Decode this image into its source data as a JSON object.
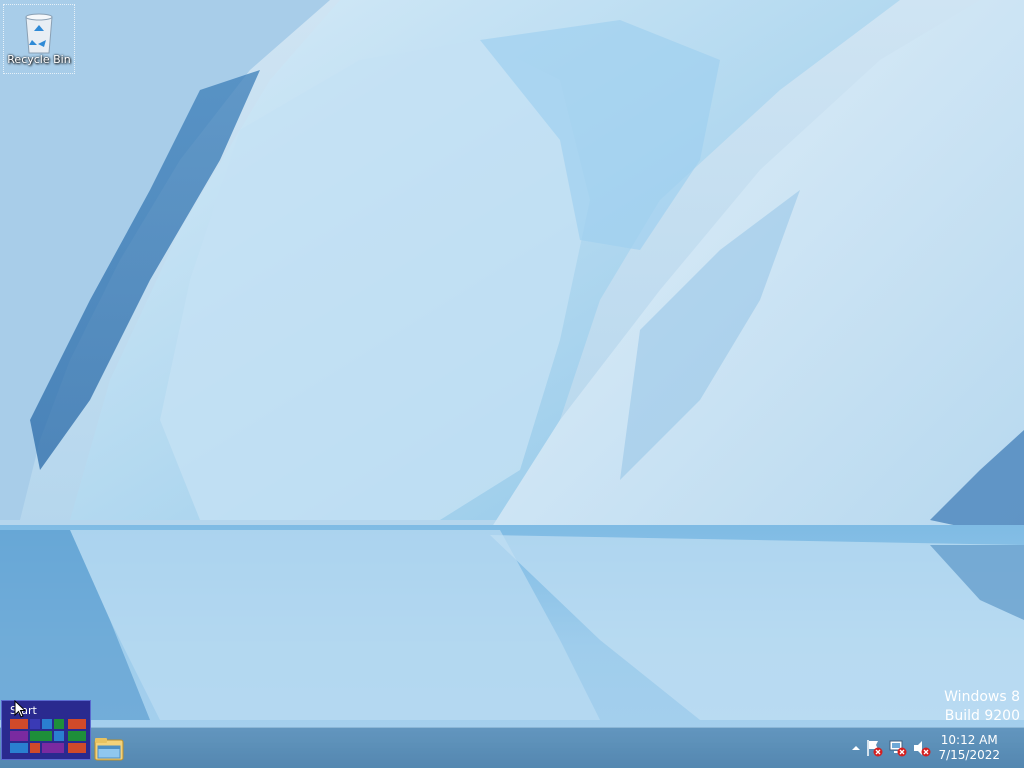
{
  "desktop": {
    "icons": [
      {
        "label": "Recycle Bin",
        "icon": "recycle-bin-icon"
      }
    ],
    "watermark": {
      "line1": "Windows 8",
      "line2": "Build 9200"
    }
  },
  "start": {
    "label": "Start",
    "tile_colors": [
      "#d04a2a",
      "#3a3ab5",
      "#2a7fd0",
      "#1e8f3a",
      "#d04a2a",
      "#7a2aa0",
      "#3a3ab5",
      "#1e8f3a",
      "#2a7fd0",
      "#d04a2a",
      "#7a2aa0",
      "#1e8f3a"
    ]
  },
  "taskbar": {
    "pinned": [
      {
        "name": "File Explorer",
        "icon": "file-explorer-icon"
      }
    ],
    "tray": {
      "icons": [
        "show-hidden-icons-chevron",
        "action-center-flag-icon",
        "network-disconnected-icon",
        "volume-muted-icon"
      ],
      "time": "10:12 AM",
      "date": "7/15/2022"
    }
  },
  "colors": {
    "taskbar": "#5b8fbb",
    "start_tile_bg": "#2a2a8f",
    "text": "#ffffff"
  }
}
